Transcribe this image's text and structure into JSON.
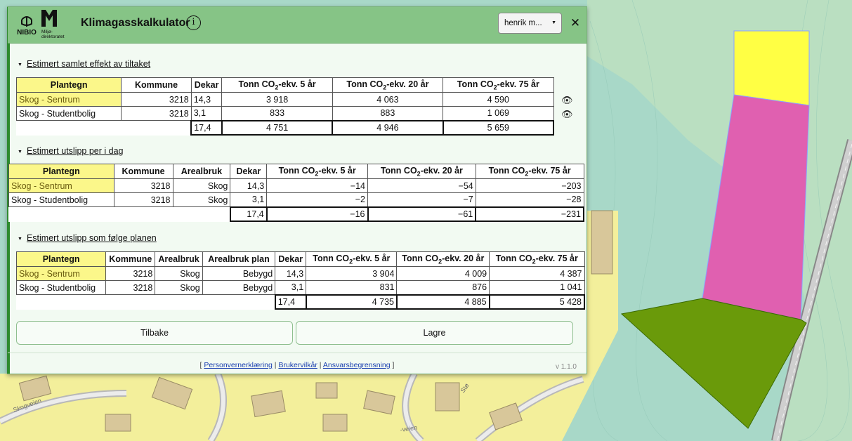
{
  "app": {
    "title": "Klimagasskalkulator",
    "logo_nibio": "NIBIO",
    "logo_miljo": "Miljø-\ndirektoratet",
    "user": "henrik m...",
    "close": "✕",
    "info": "i"
  },
  "section1": {
    "title": "Estimert samlet effekt av tiltaket",
    "headers": [
      "Plantegn",
      "Kommune",
      "Dekar",
      "Tonn CO2-ekv. 5 år",
      "Tonn CO2-ekv. 20 år",
      "Tonn CO2-ekv. 75 år"
    ],
    "rows": [
      {
        "plantegn": "Skog - Sentrum",
        "kommune": "3218",
        "dekar": "14,3",
        "t5": "3 918",
        "t20": "4 063",
        "t75": "4 590"
      },
      {
        "plantegn": "Skog - Studentbolig",
        "kommune": "3218",
        "dekar": "3,1",
        "t5": "833",
        "t20": "883",
        "t75": "1 069"
      }
    ],
    "sum": {
      "dekar": "17,4",
      "t5": "4 751",
      "t20": "4 946",
      "t75": "5 659"
    }
  },
  "section2": {
    "title": "Estimert utslipp per i dag",
    "headers": [
      "Plantegn",
      "Kommune",
      "Arealbruk",
      "Dekar",
      "Tonn CO2-ekv. 5 år",
      "Tonn CO2-ekv. 20 år",
      "Tonn CO2-ekv. 75 år"
    ],
    "rows": [
      {
        "plantegn": "Skog - Sentrum",
        "kommune": "3218",
        "arealbruk": "Skog",
        "dekar": "14,3",
        "t5": "−14",
        "t20": "−54",
        "t75": "−203"
      },
      {
        "plantegn": "Skog - Studentbolig",
        "kommune": "3218",
        "arealbruk": "Skog",
        "dekar": "3,1",
        "t5": "−2",
        "t20": "−7",
        "t75": "−28"
      }
    ],
    "sum": {
      "dekar": "17,4",
      "t5": "−16",
      "t20": "−61",
      "t75": "−231"
    }
  },
  "section3": {
    "title": "Estimert utslipp som følge planen",
    "headers": [
      "Plantegn",
      "Kommune",
      "Arealbruk",
      "Arealbruk plan",
      "Dekar",
      "Tonn CO2-ekv. 5 år",
      "Tonn CO2-ekv. 20 år",
      "Tonn CO2-ekv. 75 år"
    ],
    "rows": [
      {
        "plantegn": "Skog - Sentrum",
        "kommune": "3218",
        "arealbruk": "Skog",
        "plan": "Bebygd",
        "dekar": "14,3",
        "t5": "3 904",
        "t20": "4 009",
        "t75": "4 387"
      },
      {
        "plantegn": "Skog - Studentbolig",
        "kommune": "3218",
        "arealbruk": "Skog",
        "plan": "Bebygd",
        "dekar": "3,1",
        "t5": "831",
        "t20": "876",
        "t75": "1 041"
      }
    ],
    "sum": {
      "dekar": "17,4",
      "t5": "4 735",
      "t20": "4 885",
      "t75": "5 428"
    }
  },
  "buttons": {
    "back": "Tilbake",
    "save": "Lagre"
  },
  "footer": {
    "open": "[",
    "privacy": "Personvernerklæring",
    "sep1": "|",
    "terms": "Brukervilkår",
    "sep2": "|",
    "disclaimer": "Ansvarsbegrensning",
    "close": "]",
    "version": "v 1.1.0"
  },
  "map": {
    "labels": [
      "Skogveien",
      "Stø",
      "-veien"
    ],
    "colors": {
      "forest": "#a8d8c8",
      "residential": "#f3ef9b",
      "polygon_yellow": "#ffff44",
      "polygon_pink": "#e060b0",
      "polygon_green": "#6a9a0a"
    }
  }
}
